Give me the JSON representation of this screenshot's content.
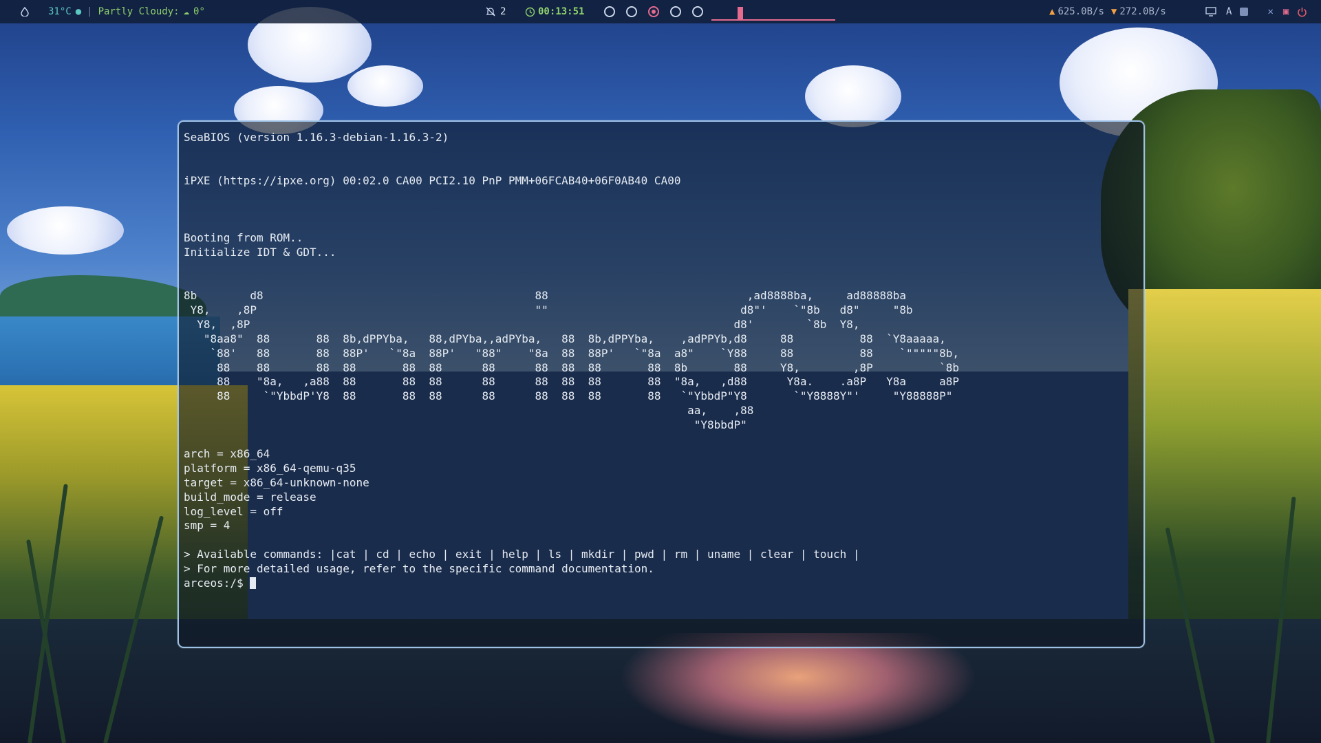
{
  "topbar": {
    "weather_temp": "31°C",
    "weather_desc": "Partly Cloudy:",
    "weather_feels": "0°",
    "notifications_count": "2",
    "uptime": "00:13:51",
    "workspaces": [
      {
        "active": false
      },
      {
        "active": false
      },
      {
        "active": true
      },
      {
        "active": false
      },
      {
        "active": false
      }
    ],
    "net_up": "625.0B/s",
    "net_down": "272.0B/s",
    "keyboard_layout": "A"
  },
  "terminal": {
    "lines": [
      "SeaBIOS (version 1.16.3-debian-1.16.3-2)",
      "",
      "",
      "iPXE (https://ipxe.org) 00:02.0 CA00 PCI2.10 PnP PMM+06FCAB40+06F0AB40 CA00",
      "",
      "",
      "",
      "Booting from ROM..",
      "Initialize IDT & GDT...",
      "",
      "",
      "8b        d8                                         88                              ,ad8888ba,     ad88888ba",
      " Y8,    ,8P                                          \"\"                             d8\"'    `\"8b   d8\"     \"8b",
      "  Y8,  ,8P                                                                         d8'        `8b  Y8,",
      "   \"8aa8\"  88       88  8b,dPPYba,   88,dPYba,,adPYba,   88  8b,dPPYba,    ,adPPYb,d8     88          88  `Y8aaaaa,",
      "    `88'   88       88  88P'   `\"8a  88P'   \"88\"    \"8a  88  88P'   `\"8a  a8\"    `Y88     88          88    `\"\"\"\"\"8b,",
      "     88    88       88  88       88  88      88      88  88  88       88  8b       88     Y8,        ,8P          `8b",
      "     88    \"8a,   ,a88  88       88  88      88      88  88  88       88  \"8a,   ,d88      Y8a.    .a8P   Y8a     a8P",
      "     88     `\"YbbdP'Y8  88       88  88      88      88  88  88       88   `\"YbbdP\"Y8       `\"Y8888Y\"'     \"Y88888P\"",
      "                                                                            aa,    ,88",
      "                                                                             \"Y8bbdP\"",
      "",
      "arch = x86_64",
      "platform = x86_64-qemu-q35",
      "target = x86_64-unknown-none",
      "build_mode = release",
      "log_level = off",
      "smp = 4",
      "",
      "> Available commands: |cat | cd | echo | exit | help | ls | mkdir | pwd | rm | uname | clear | touch |",
      "> For more detailed usage, refer to the specific command documentation."
    ],
    "prompt": "arceos:/$ "
  }
}
